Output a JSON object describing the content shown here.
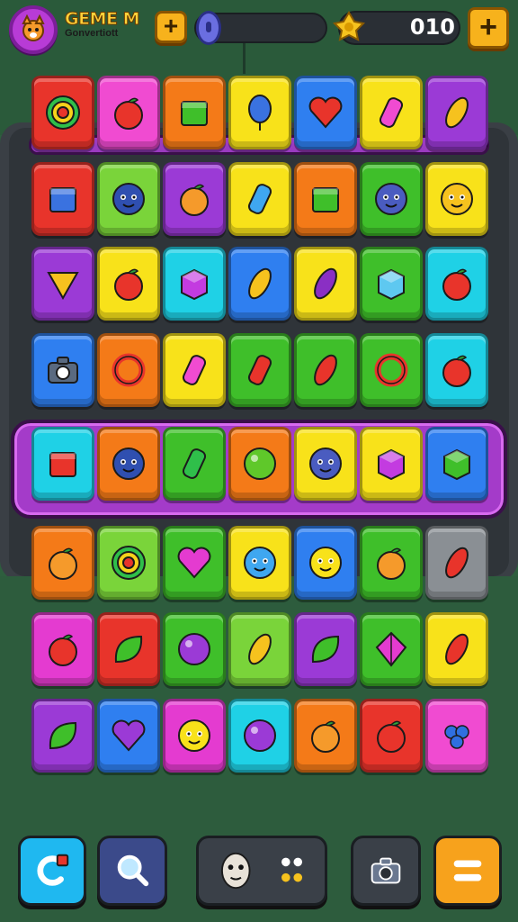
{
  "header": {
    "title": "GEME M",
    "subtitle": "Gonvertiott",
    "coins": "010",
    "avatar_icon": "fox-avatar-icon",
    "energy_icon": "energy-orb-icon",
    "coin_icon": "gold-coin-icon"
  },
  "colors": {
    "red": "#e8342b",
    "pink": "#f04bd1",
    "orange": "#f47a18",
    "yellow": "#f8e21a",
    "blue": "#2f7ff0",
    "green": "#3fbf2a",
    "purple": "#9b3ad6",
    "cyan": "#1fd1e6",
    "gray": "#8a8f94",
    "lime": "#7ad43a",
    "magenta": "#e43bd0"
  },
  "board": {
    "rows": [
      [
        {
          "bg": "red",
          "icon": "swirl-candy-icon"
        },
        {
          "bg": "pink",
          "icon": "strawberry-pair-icon"
        },
        {
          "bg": "orange",
          "icon": "green-box-icon"
        },
        {
          "bg": "yellow",
          "icon": "blue-balloon-icon"
        },
        {
          "bg": "blue",
          "icon": "red-heart-icon"
        },
        {
          "bg": "yellow",
          "icon": "pink-bottle-icon"
        },
        {
          "bg": "purple",
          "icon": "banana-chili-icon"
        }
      ],
      [
        {
          "bg": "red",
          "icon": "castle-icon"
        },
        {
          "bg": "lime",
          "icon": "blue-blob-face-icon"
        },
        {
          "bg": "purple",
          "icon": "orange-ball-icon"
        },
        {
          "bg": "yellow",
          "icon": "soda-cup-icon"
        },
        {
          "bg": "orange",
          "icon": "green-bin-icon"
        },
        {
          "bg": "green",
          "icon": "ghost-face-icon"
        },
        {
          "bg": "yellow",
          "icon": "yellow-bunny-icon"
        }
      ],
      [
        {
          "bg": "purple",
          "icon": "cheese-slice-icon"
        },
        {
          "bg": "yellow",
          "icon": "pink-strawberry-icon"
        },
        {
          "bg": "cyan",
          "icon": "ice-cube-icon"
        },
        {
          "bg": "blue",
          "icon": "banana-icon"
        },
        {
          "bg": "yellow",
          "icon": "eggplant-icon"
        },
        {
          "bg": "green",
          "icon": "watermelon-slice-icon"
        },
        {
          "bg": "cyan",
          "icon": "red-strawberry-icon"
        }
      ],
      [
        {
          "bg": "blue",
          "icon": "camera-icon"
        },
        {
          "bg": "orange",
          "icon": "ring-icon"
        },
        {
          "bg": "yellow",
          "icon": "spray-bottle-icon"
        },
        {
          "bg": "green",
          "icon": "red-pencil-icon"
        },
        {
          "bg": "green",
          "icon": "red-chili-icon"
        },
        {
          "bg": "green",
          "icon": "red-ring-icon"
        },
        {
          "bg": "cyan",
          "icon": "red-apple-icon"
        }
      ],
      [
        {
          "bg": "cyan",
          "icon": "red-sneaker-icon"
        },
        {
          "bg": "orange",
          "icon": "blue-blob-eyes-icon"
        },
        {
          "bg": "green",
          "icon": "green-crayon-icon"
        },
        {
          "bg": "orange",
          "icon": "lime-icon"
        },
        {
          "bg": "yellow",
          "icon": "purple-berry-face-icon"
        },
        {
          "bg": "yellow",
          "icon": "purple-cube-icon"
        },
        {
          "bg": "blue",
          "icon": "green-cube-face-icon"
        }
      ],
      [
        {
          "bg": "orange",
          "icon": "orange-fruit-icon"
        },
        {
          "bg": "lime",
          "icon": "candy-swirl-icon"
        },
        {
          "bg": "green",
          "icon": "magenta-heart-icon"
        },
        {
          "bg": "yellow",
          "icon": "blue-smiley-icon"
        },
        {
          "bg": "blue",
          "icon": "yellow-ghost-icon"
        },
        {
          "bg": "green",
          "icon": "orange-spiral-icon"
        },
        {
          "bg": "gray",
          "icon": "orange-pepper-icon"
        }
      ],
      [
        {
          "bg": "magenta",
          "icon": "tomato-icon"
        },
        {
          "bg": "red",
          "icon": "green-leaf-berry-icon"
        },
        {
          "bg": "green",
          "icon": "red-plum-icon"
        },
        {
          "bg": "lime",
          "icon": "banana-bunch-icon"
        },
        {
          "bg": "purple",
          "icon": "green-leaf-icon"
        },
        {
          "bg": "green",
          "icon": "kite-icon"
        },
        {
          "bg": "yellow",
          "icon": "red-pepper-icon"
        }
      ],
      [
        {
          "bg": "purple",
          "icon": "strawberry-leaf-icon"
        },
        {
          "bg": "blue",
          "icon": "purple-heart-face-icon"
        },
        {
          "bg": "magenta",
          "icon": "yellow-ghost-icon"
        },
        {
          "bg": "cyan",
          "icon": "purple-plum-icon"
        },
        {
          "bg": "orange",
          "icon": "orange-pumpkin-icon"
        },
        {
          "bg": "red",
          "icon": "big-strawberry-icon"
        },
        {
          "bg": "pink",
          "icon": "blueberries-icon"
        }
      ]
    ]
  },
  "toolbar": [
    {
      "icon": "undo-icon",
      "bg": "cyan"
    },
    {
      "icon": "search-icon",
      "bg": "blue"
    },
    {
      "icon": "mask-icon",
      "bg": "dark"
    },
    {
      "icon": "camera-settings-icon",
      "bg": "dark"
    },
    {
      "icon": "menu-icon",
      "bg": "orange"
    }
  ]
}
